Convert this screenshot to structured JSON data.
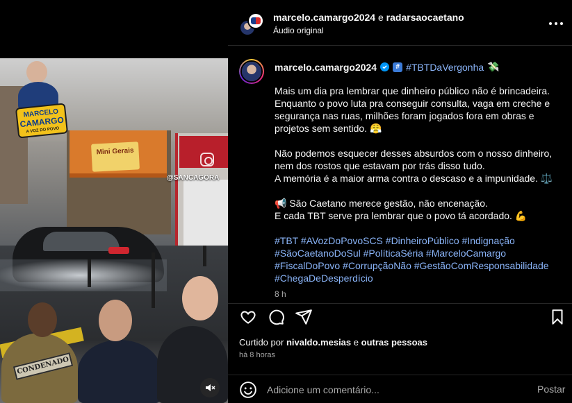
{
  "header": {
    "user1": "marcelo.camargo2024",
    "conjunction": "e",
    "user2": "radarsaocaetano",
    "audio": "Áudio original"
  },
  "media": {
    "video_tag": "@SANCAGORA",
    "shop_sign": "Mini Gerais",
    "badge_line1": "MARCELO",
    "badge_line2": "CAMARGO",
    "badge_line3": "A VOZ DO POVO",
    "stamp": "CONDENADO"
  },
  "post": {
    "username": "marcelo.camargo2024",
    "title_tag": "#TBTDaVergonha",
    "title_emoji": "💸",
    "paragraph1": "Mais um dia pra lembrar que dinheiro público não é brincadeira. Enquanto o povo luta pra conseguir consulta, vaga em creche e segurança nas ruas, milhões foram jogados fora em obras e projetos sem sentido. 😤",
    "paragraph2_line1": "Não podemos esquecer desses absurdos com o nosso dinheiro, nem dos rostos que estavam por trás disso tudo.",
    "paragraph2_line2": "A memória é a maior arma contra o descaso e a impunidade. ⚖️",
    "paragraph3_line1": "📢 São Caetano merece gestão, não encenação.",
    "paragraph3_line2": "E cada TBT serve pra lembrar que o povo tá acordado. 💪",
    "hashtags": "#TBT #AVozDoPovoSCS #DinheiroPúblico #Indignação #SãoCaetanoDoSul #PolíticaSéria #MarceloCamargo #FiscalDoPovo #CorrupçãoNão #GestãoComResponsabilidade #ChegaDeDesperdício",
    "time": "8 h"
  },
  "engagement": {
    "liked_by_prefix": "Curtido por",
    "liked_by_user": "nivaldo.mesias",
    "liked_by_joiner": "e",
    "liked_by_others": "outras pessoas",
    "time_ago": "há 8 horas"
  },
  "comment": {
    "placeholder": "Adicione um comentário...",
    "post_label": "Postar"
  },
  "colors": {
    "link": "#8ab4f8",
    "verified": "#0095f6",
    "muted": "#a8a8a8"
  }
}
